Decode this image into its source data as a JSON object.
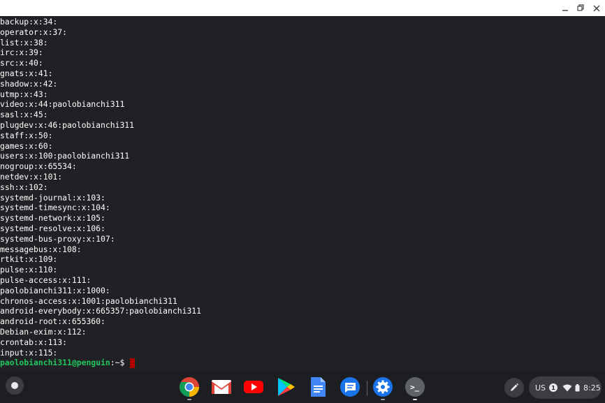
{
  "terminal": {
    "lines": [
      "backup:x:34:",
      "operator:x:37:",
      "list:x:38:",
      "irc:x:39:",
      "src:x:40:",
      "gnats:x:41:",
      "shadow:x:42:",
      "utmp:x:43:",
      "video:x:44:paolobianchi311",
      "sasl:x:45:",
      "plugdev:x:46:paolobianchi311",
      "staff:x:50:",
      "games:x:60:",
      "users:x:100:paolobianchi311",
      "nogroup:x:65534:",
      "netdev:x:101:",
      "ssh:x:102:",
      "systemd-journal:x:103:",
      "systemd-timesync:x:104:",
      "systemd-network:x:105:",
      "systemd-resolve:x:106:",
      "systemd-bus-proxy:x:107:",
      "messagebus:x:108:",
      "rtkit:x:109:",
      "pulse:x:110:",
      "pulse-access:x:111:",
      "paolobianchi311:x:1000:",
      "chronos-access:x:1001:paolobianchi311",
      "android-everybody:x:665357:paolobianchi311",
      "android-root:x:655360:",
      "Debian-exim:x:112:",
      "crontab:x:113:",
      "input:x:115:"
    ],
    "prompt_user": "paolobianchi311@penguin",
    "prompt_path": ":~$"
  },
  "window_controls": {
    "minimize_icon": "minimize-icon",
    "restore_icon": "restore-icon",
    "close_icon": "close-icon"
  },
  "shelf": {
    "apps": [
      "Chrome",
      "Gmail",
      "YouTube",
      "Play Store",
      "Docs",
      "Messages",
      "Settings",
      "Terminal"
    ],
    "tray": {
      "keyboard_layout": "US",
      "notification_count": "1",
      "time": "8:25"
    }
  },
  "colors": {
    "terminal_bg": "#202124",
    "prompt_user": "#22c55e",
    "cursor": "#b00000"
  }
}
